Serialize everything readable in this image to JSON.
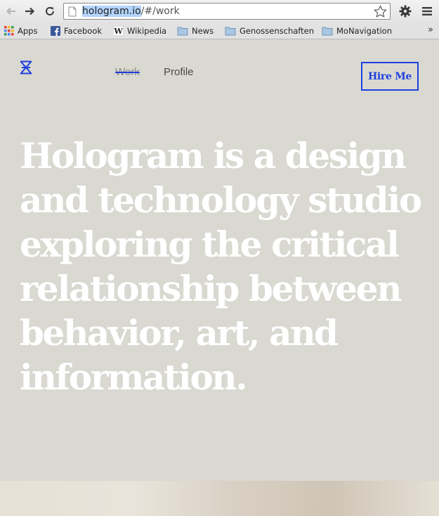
{
  "browser": {
    "url_host": "hologram.io",
    "url_path": "/#/work",
    "bookmarks": [
      {
        "label": "Apps",
        "icon": "apps-grid-icon"
      },
      {
        "label": "Facebook",
        "icon": "facebook-icon"
      },
      {
        "label": "Wikipedia",
        "icon": "wikipedia-icon"
      },
      {
        "label": "News",
        "icon": "folder-icon"
      },
      {
        "label": "Genossenschaften",
        "icon": "folder-icon"
      },
      {
        "label": "MoNavigation",
        "icon": "folder-icon"
      }
    ],
    "overflow": "»"
  },
  "site": {
    "nav": {
      "work": "Work",
      "profile": "Profile"
    },
    "hire_label": "Hire Me",
    "hero_text": "Hologram is a design and technology studio exploring the critical relationship between behavior, art, and information.",
    "accent_color": "#1f3fe0",
    "background_color": "#d9d8d1"
  }
}
